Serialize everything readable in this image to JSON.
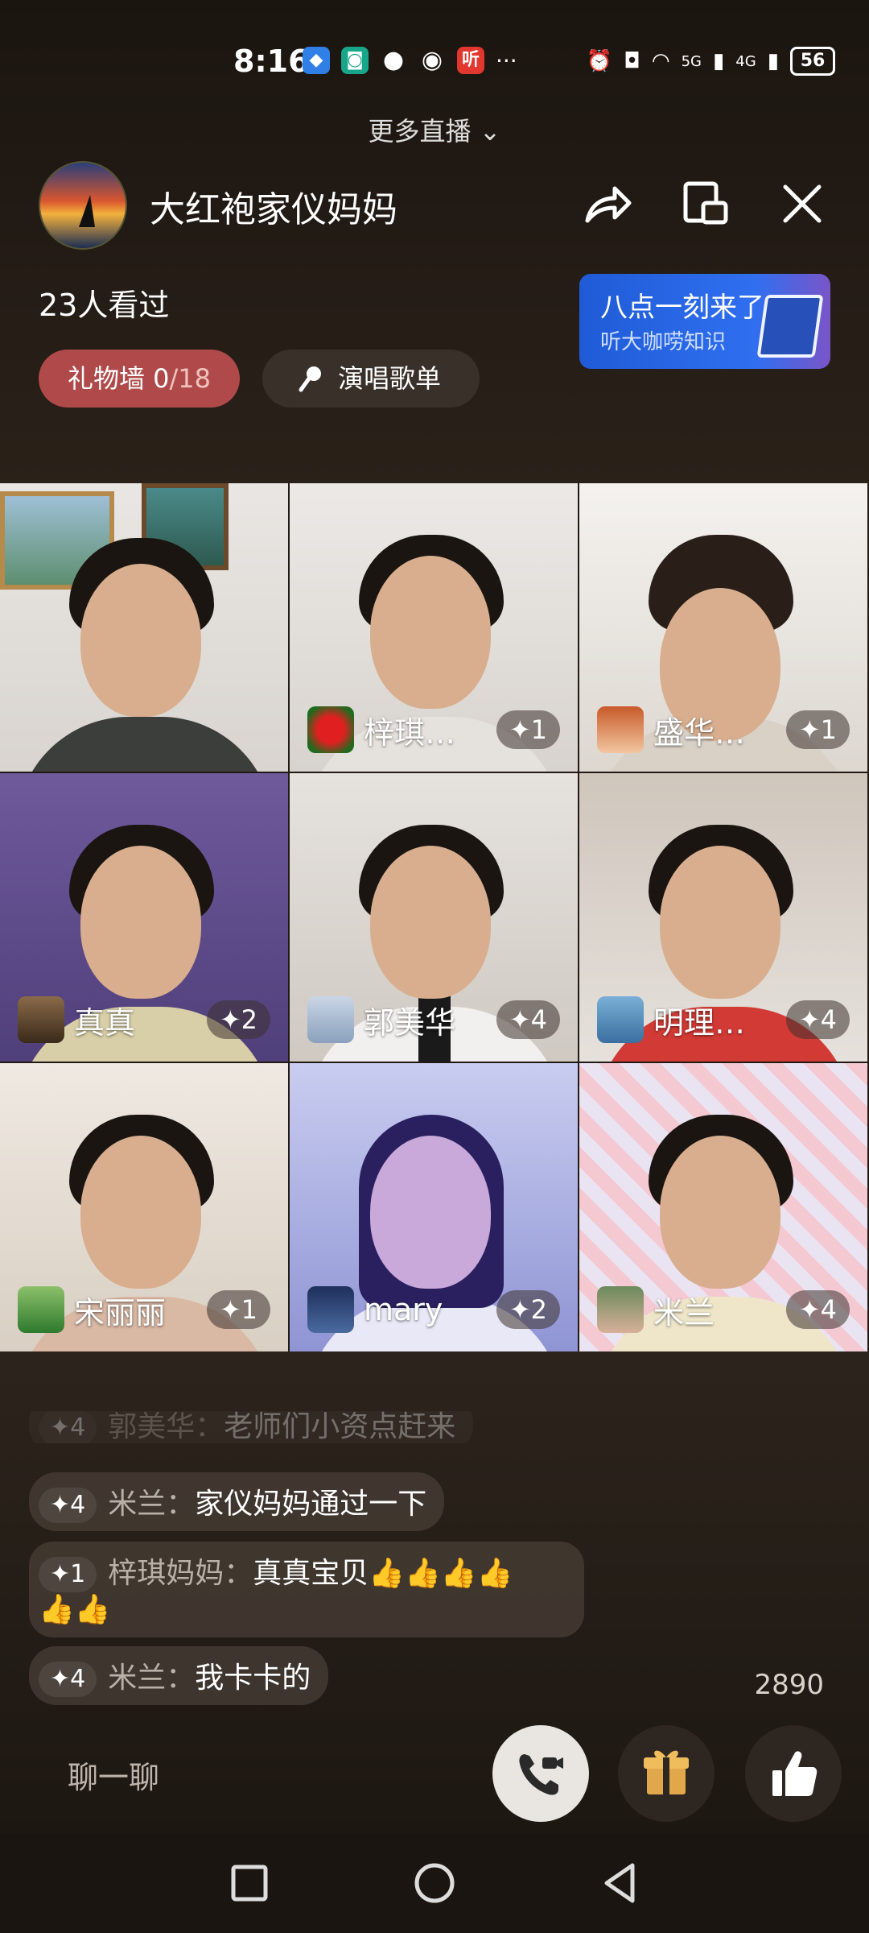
{
  "status_bar": {
    "time": "8:16",
    "notif_icons": [
      "shield-icon",
      "mi-icon",
      "message-icon",
      "wechat-icon",
      "ting-icon"
    ],
    "ting_label": "听",
    "more": "···",
    "network_5g": "5G",
    "network_4g": "4G",
    "battery": "56"
  },
  "header": {
    "more_live": "更多直播 ⌄",
    "room_title": "大红袍家仪妈妈",
    "views": "23人看过",
    "promo_line1": "八点一刻来了",
    "promo_line2": "听大咖唠知识",
    "gift_wall_label": "礼物墙",
    "gift_wall_count": "0",
    "gift_wall_total": "/18",
    "songs_label": "演唱歌单"
  },
  "tiles": [
    {
      "name": "",
      "level": "",
      "show_tag": false
    },
    {
      "name": "梓琪…",
      "level": "✦1"
    },
    {
      "name": "盛华…",
      "level": "✦1"
    },
    {
      "name": "真真",
      "level": "✦2"
    },
    {
      "name": "郭美华",
      "level": "✦4"
    },
    {
      "name": "明理…",
      "level": "✦4"
    },
    {
      "name": "宋丽丽",
      "level": "✦1"
    },
    {
      "name": "mary",
      "level": "✦2"
    },
    {
      "name": "米兰",
      "level": "✦4"
    }
  ],
  "chat": [
    {
      "level": "✦4",
      "name": "郭美华：",
      "text": "老师们小资点赶来"
    },
    {
      "level": "✦4",
      "name": "米兰：",
      "text": "家仪妈妈通过一下"
    },
    {
      "level": "✦1",
      "name": "梓琪妈妈：",
      "text": "真真宝贝👍👍👍👍",
      "text2": "👍👍"
    },
    {
      "level": "✦4",
      "name": "米兰：",
      "text": "我卡卡的"
    }
  ],
  "footer": {
    "like_count": "2890",
    "chat_placeholder": "聊一聊"
  },
  "colors": {
    "gift_wall": "#b04a4a",
    "promo": "#2f6ff0",
    "background": "#211a14"
  }
}
